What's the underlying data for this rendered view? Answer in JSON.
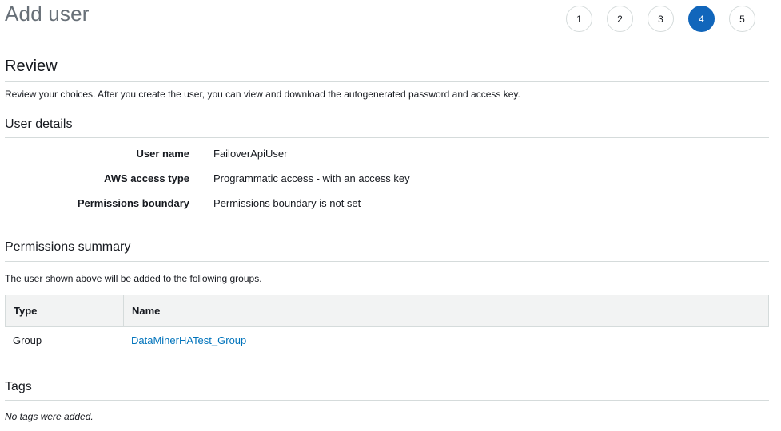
{
  "header": {
    "title": "Add user",
    "steps": [
      {
        "label": "1",
        "active": false
      },
      {
        "label": "2",
        "active": false
      },
      {
        "label": "3",
        "active": false
      },
      {
        "label": "4",
        "active": true
      },
      {
        "label": "5",
        "active": false
      }
    ]
  },
  "review": {
    "heading": "Review",
    "description": "Review your choices. After you create the user, you can view and download the autogenerated password and access key."
  },
  "user_details": {
    "heading": "User details",
    "rows": [
      {
        "label": "User name",
        "value": "FailoverApiUser"
      },
      {
        "label": "AWS access type",
        "value": "Programmatic access - with an access key"
      },
      {
        "label": "Permissions boundary",
        "value": "Permissions boundary is not set"
      }
    ]
  },
  "permissions": {
    "heading": "Permissions summary",
    "description": "The user shown above will be added to the following groups.",
    "columns": [
      "Type",
      "Name"
    ],
    "rows": [
      {
        "type": "Group",
        "name": "DataMinerHATest_Group"
      }
    ]
  },
  "tags": {
    "heading": "Tags",
    "empty_text": "No tags were added."
  },
  "colors": {
    "active_step": "#1166bb",
    "link": "#0073bb",
    "title_gray": "#687078",
    "rule": "#d5dbdb"
  }
}
